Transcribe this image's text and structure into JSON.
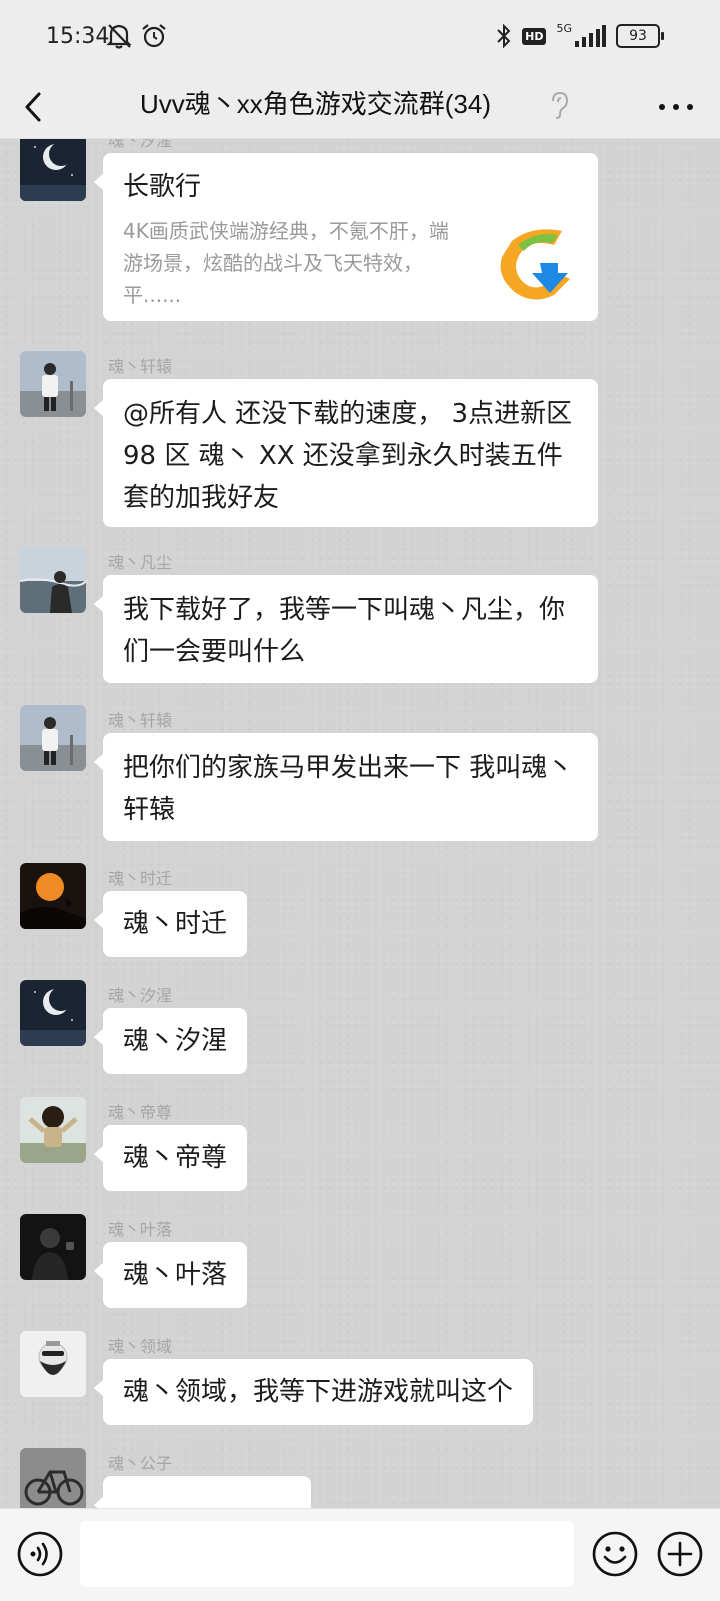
{
  "status_bar": {
    "time": "15:34",
    "network": "5G",
    "battery": "93"
  },
  "header": {
    "title": "Uvv魂丶xx角色游戏交流群(34)"
  },
  "messages": [
    {
      "sender": "魂丶汐湦",
      "card_title": "长歌行",
      "card_desc": "4K画质武侠端游经典，不氪不肝，端游场景，炫酷的战斗及飞天特效，平......"
    },
    {
      "sender": "魂丶轩辕",
      "text": "@所有人  还没下载的速度，  3点进新区 98 区 魂丶 XX  还没拿到永久时装五件套的加我好友"
    },
    {
      "sender": "魂丶凡尘",
      "text": "我下载好了，我等一下叫魂丶凡尘，你们一会要叫什么"
    },
    {
      "sender": "魂丶轩辕",
      "text": "把你们的家族马甲发出来一下 我叫魂丶轩辕"
    },
    {
      "sender": "魂丶时迁",
      "text": "魂丶时迁"
    },
    {
      "sender": "魂丶汐湦",
      "text": "魂丶汐湦"
    },
    {
      "sender": "魂丶帝尊",
      "text": "魂丶帝尊"
    },
    {
      "sender": "魂丶叶落",
      "text": "魂丶叶落"
    },
    {
      "sender": "魂丶领域",
      "text": "魂丶领域，我等下进游戏就叫这个"
    },
    {
      "sender": "魂丶公子",
      "text": ""
    }
  ],
  "input": {
    "placeholder": ""
  },
  "colors": {
    "chat_background": "#d3d3d3",
    "bubble": "#ffffff",
    "bar": "#ededed",
    "sender_name": "#a6a6a6"
  }
}
